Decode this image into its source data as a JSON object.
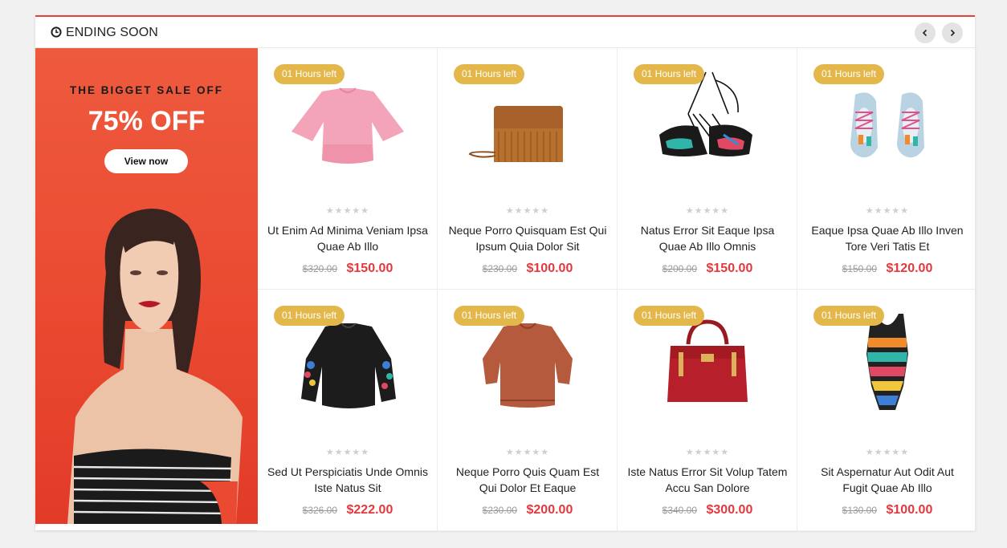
{
  "header": {
    "title": "ENDING SOON"
  },
  "banner": {
    "tagline": "THE BIGGET SALE OFF",
    "discount": "75% OFF",
    "button_label": "View now"
  },
  "colors": {
    "accent": "#e8403a",
    "badge": "#e4b74a",
    "price": "#e4383e",
    "banner": "#ea4a31"
  },
  "products": [
    {
      "badge": "01 Hours left",
      "image": "pink-blouse",
      "rating": 0,
      "stars": "★★★★★",
      "name": "Ut Enim Ad Minima Veniam Ipsa Quae Ab Illo",
      "old_price": "$320.00",
      "price": "$150.00"
    },
    {
      "badge": "01 Hours left",
      "image": "fringe-bag",
      "rating": 0,
      "stars": "★★★★★",
      "name": "Neque Porro Quisquam Est Qui Ipsum Quia Dolor Sit",
      "old_price": "$230.00",
      "price": "$100.00"
    },
    {
      "badge": "01 Hours left",
      "image": "bikini-top",
      "rating": 0,
      "stars": "★★★★★",
      "name": "Natus Error Sit Eaque Ipsa Quae Ab Illo Omnis",
      "old_price": "$200.00",
      "price": "$150.00"
    },
    {
      "badge": "01 Hours left",
      "image": "kids-shoes",
      "rating": 0,
      "stars": "★★★★★",
      "name": "Eaque Ipsa Quae Ab Illo Inven Tore Veri Tatis Et",
      "old_price": "$150.00",
      "price": "$120.00"
    },
    {
      "badge": "01 Hours left",
      "image": "black-sweatshirt",
      "rating": 0,
      "stars": "★★★★★",
      "name": "Sed Ut Perspiciatis Unde Omnis Iste Natus Sit",
      "old_price": "$326.00",
      "price": "$222.00"
    },
    {
      "badge": "01 Hours left",
      "image": "rust-sweater",
      "rating": 0,
      "stars": "★★★★★",
      "name": "Neque Porro Quis Quam Est Qui Dolor Et Eaque",
      "old_price": "$230.00",
      "price": "$200.00"
    },
    {
      "badge": "01 Hours left",
      "image": "red-handbag",
      "rating": 0,
      "stars": "★★★★★",
      "name": "Iste Natus Error Sit Volup Tatem Accu San Dolore",
      "old_price": "$340.00",
      "price": "$300.00"
    },
    {
      "badge": "01 Hours left",
      "image": "swimsuit",
      "rating": 0,
      "stars": "★★★★★",
      "name": "Sit Aspernatur Aut Odit Aut Fugit Quae Ab Illo",
      "old_price": "$130.00",
      "price": "$100.00"
    }
  ]
}
